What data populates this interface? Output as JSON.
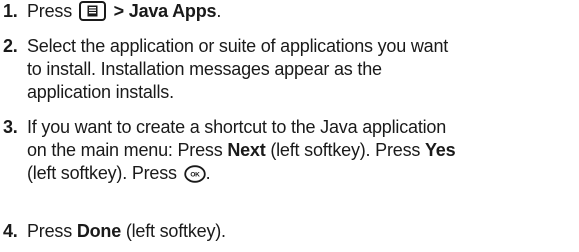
{
  "steps": [
    {
      "number": "1.",
      "before_key": "Press",
      "key_icon": "menu-key-icon",
      "after_key": "> Java Apps",
      "end": "."
    },
    {
      "number": "2.",
      "lines": [
        "Select the application or suite of applications you want",
        "to install. Installation messages appear as the",
        "application installs."
      ]
    },
    {
      "number": "3.",
      "line1": "If you want to create a shortcut to the Java application",
      "line2_a": "on the main menu: Press ",
      "line2_b": "Next",
      "line2_c": " (left softkey). Press ",
      "line2_d": "Yes",
      "line3_a": "(left softkey). Press ",
      "key_icon": "ok-key-icon",
      "line3_end": "."
    },
    {
      "number": "4.",
      "a": "Press ",
      "b": "Done",
      "c": " (left softkey)."
    }
  ]
}
